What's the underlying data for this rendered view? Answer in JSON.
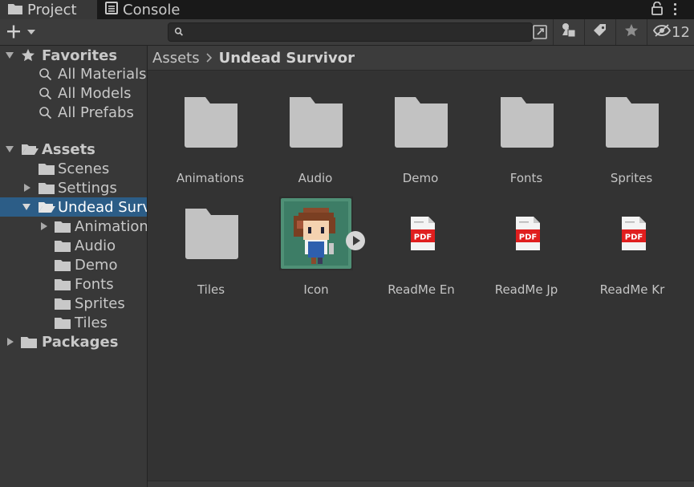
{
  "tabs": [
    {
      "label": "Project",
      "icon": "folder-icon",
      "active": true
    },
    {
      "label": "Console",
      "icon": "console-icon",
      "active": false
    }
  ],
  "toolbar": {
    "search_value": "",
    "hidden_count": "12"
  },
  "tree": {
    "favorites": {
      "label": "Favorites",
      "items": [
        "All Materials",
        "All Models",
        "All Prefabs"
      ]
    },
    "assets": {
      "label": "Assets",
      "children": [
        "Scenes",
        "Settings",
        "Undead Survivor"
      ],
      "selected": "Undead Survivor",
      "sub_children": [
        "Animation",
        "Audio",
        "Demo",
        "Fonts",
        "Sprites",
        "Tiles"
      ]
    },
    "packages": {
      "label": "Packages"
    }
  },
  "breadcrumb": {
    "root": "Assets",
    "current": "Undead Survivor"
  },
  "grid": {
    "items": [
      {
        "name": "Animations",
        "type": "folder"
      },
      {
        "name": "Audio",
        "type": "folder"
      },
      {
        "name": "Demo",
        "type": "folder"
      },
      {
        "name": "Fonts",
        "type": "folder"
      },
      {
        "name": "Sprites",
        "type": "folder"
      },
      {
        "name": "Tiles",
        "type": "folder"
      },
      {
        "name": "Icon",
        "type": "sprite"
      },
      {
        "name": "ReadMe En",
        "type": "pdf"
      },
      {
        "name": "ReadMe Jp",
        "type": "pdf"
      },
      {
        "name": "ReadMe Kr",
        "type": "pdf"
      }
    ],
    "pdf_badge": "PDF"
  },
  "colors": {
    "selection": "#2c5d87",
    "folder": "#c2c2c2",
    "pdf_red": "#e01e1e"
  }
}
